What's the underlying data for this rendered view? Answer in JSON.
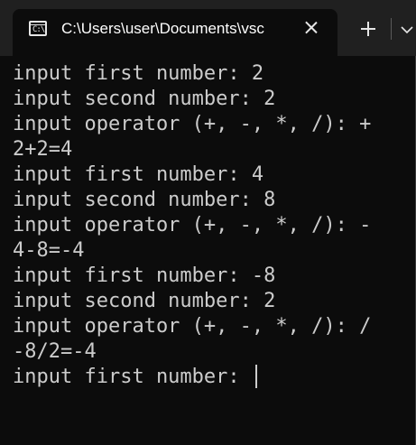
{
  "tab": {
    "title": "C:\\Users\\user\\Documents\\vsc",
    "icon": "terminal-icon",
    "icon_glyph": "C:\\",
    "close_icon": "close-icon"
  },
  "titlebar": {
    "new_tab_icon": "plus-icon",
    "dropdown_icon": "chevron-down-icon"
  },
  "terminal": {
    "lines": [
      "input first number: 2",
      "input second number: 2",
      "input operator (+, -, *, /): +",
      "2+2=4",
      "input first number: 4",
      "input second number: 8",
      "input operator (+, -, *, /): -",
      "4-8=-4",
      "input first number: -8",
      "input second number: 2",
      "input operator (+, -, *, /): /",
      "-8/2=-4",
      "input first number: "
    ]
  },
  "colors": {
    "titlebar_bg": "#202020",
    "terminal_bg": "#0c0c0c",
    "text": "#cccccc"
  }
}
